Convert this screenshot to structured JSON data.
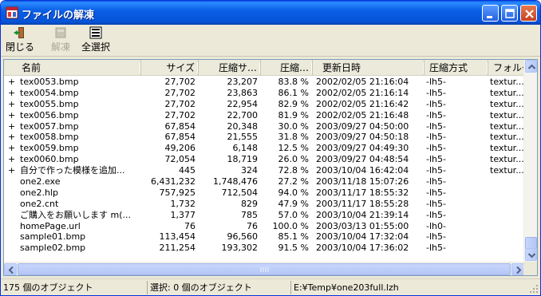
{
  "window": {
    "title": "ファイルの解凍",
    "accent": "#0a5be0",
    "title_icon": "archive-app-icon"
  },
  "toolbar": {
    "close_label": "閉じる",
    "extract_label": "解凍",
    "select_all_label": "全選択"
  },
  "list": {
    "columns": [
      "名前",
      "サイズ",
      "圧縮サ…",
      "圧縮…",
      "更新日時",
      "圧縮方式",
      "フォルダ"
    ],
    "rows": [
      {
        "marker": "+",
        "name": "tex0053.bmp",
        "size": "27,702",
        "packed": "23,207",
        "ratio": "83.8 %",
        "date": "2002/02/05 21:16:04",
        "method": "-lh5-",
        "folder": "textur..."
      },
      {
        "marker": "+",
        "name": "tex0054.bmp",
        "size": "27,702",
        "packed": "23,863",
        "ratio": "86.1 %",
        "date": "2002/02/05 21:16:14",
        "method": "-lh5-",
        "folder": "textur..."
      },
      {
        "marker": "+",
        "name": "tex0055.bmp",
        "size": "27,702",
        "packed": "22,954",
        "ratio": "82.9 %",
        "date": "2002/02/05 21:16:42",
        "method": "-lh5-",
        "folder": "textur..."
      },
      {
        "marker": "+",
        "name": "tex0056.bmp",
        "size": "27,702",
        "packed": "22,700",
        "ratio": "81.9 %",
        "date": "2002/02/05 21:16:48",
        "method": "-lh5-",
        "folder": "textur..."
      },
      {
        "marker": "+",
        "name": "tex0057.bmp",
        "size": "67,854",
        "packed": "20,348",
        "ratio": "30.0 %",
        "date": "2003/09/27 04:50:00",
        "method": "-lh5-",
        "folder": "textur..."
      },
      {
        "marker": "+",
        "name": "tex0058.bmp",
        "size": "67,854",
        "packed": "21,555",
        "ratio": "31.8 %",
        "date": "2003/09/27 04:50:18",
        "method": "-lh5-",
        "folder": "textur..."
      },
      {
        "marker": "+",
        "name": "tex0059.bmp",
        "size": "49,206",
        "packed": "6,148",
        "ratio": "12.5 %",
        "date": "2003/09/27 04:49:30",
        "method": "-lh5-",
        "folder": "textur..."
      },
      {
        "marker": "+",
        "name": "tex0060.bmp",
        "size": "72,054",
        "packed": "18,719",
        "ratio": "26.0 %",
        "date": "2003/09/27 04:48:54",
        "method": "-lh5-",
        "folder": "textur..."
      },
      {
        "marker": "+",
        "name": "自分で作った模様を追加...",
        "size": "445",
        "packed": "324",
        "ratio": "72.8 %",
        "date": "2003/10/04 16:42:04",
        "method": "-lh5-",
        "folder": "textur..."
      },
      {
        "marker": "",
        "name": "one2.exe",
        "size": "6,431,232",
        "packed": "1,748,476",
        "ratio": "27.2 %",
        "date": "2003/11/18 15:07:26",
        "method": "-lh5-",
        "folder": ""
      },
      {
        "marker": "",
        "name": "one2.hlp",
        "size": "757,925",
        "packed": "712,504",
        "ratio": "94.0 %",
        "date": "2003/11/17 18:55:32",
        "method": "-lh5-",
        "folder": ""
      },
      {
        "marker": "",
        "name": "one2.cnt",
        "size": "1,732",
        "packed": "829",
        "ratio": "47.9 %",
        "date": "2003/11/17 18:55:28",
        "method": "-lh5-",
        "folder": ""
      },
      {
        "marker": "",
        "name": "ご購入をお願いします m(...",
        "size": "1,377",
        "packed": "785",
        "ratio": "57.0 %",
        "date": "2003/10/04 21:39:14",
        "method": "-lh5-",
        "folder": ""
      },
      {
        "marker": "",
        "name": "homePage.url",
        "size": "76",
        "packed": "76",
        "ratio": "100.0 %",
        "date": "2003/03/13 01:55:00",
        "method": "-lh0-",
        "folder": ""
      },
      {
        "marker": "",
        "name": "sample01.bmp",
        "size": "113,454",
        "packed": "96,560",
        "ratio": "85.1 %",
        "date": "2003/10/04 17:32:04",
        "method": "-lh5-",
        "folder": ""
      },
      {
        "marker": "",
        "name": "sample02.bmp",
        "size": "211,254",
        "packed": "193,302",
        "ratio": "91.5 %",
        "date": "2003/10/04 17:36:02",
        "method": "-lh5-",
        "folder": ""
      }
    ]
  },
  "status": {
    "count": "175 個のオブジェクト",
    "selected": "選択: 0 個のオブジェクト",
    "path": "E:¥Temp¥one203full.lzh"
  }
}
